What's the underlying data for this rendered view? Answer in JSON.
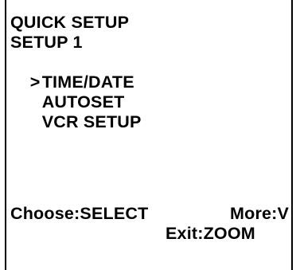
{
  "screen": {
    "title": "QUICK SETUP",
    "subtitle": "SETUP 1",
    "cursor_symbol": ">",
    "menu_items": [
      {
        "label": "TIME/DATE",
        "selected": true
      },
      {
        "label": "AUTOSET",
        "selected": false
      },
      {
        "label": "VCR SETUP",
        "selected": false
      }
    ],
    "hints": {
      "choose": "Choose:SELECT",
      "more": "More:V",
      "exit": "Exit:ZOOM"
    },
    "colors": {
      "background": "#ffffff",
      "text": "#000000"
    }
  }
}
